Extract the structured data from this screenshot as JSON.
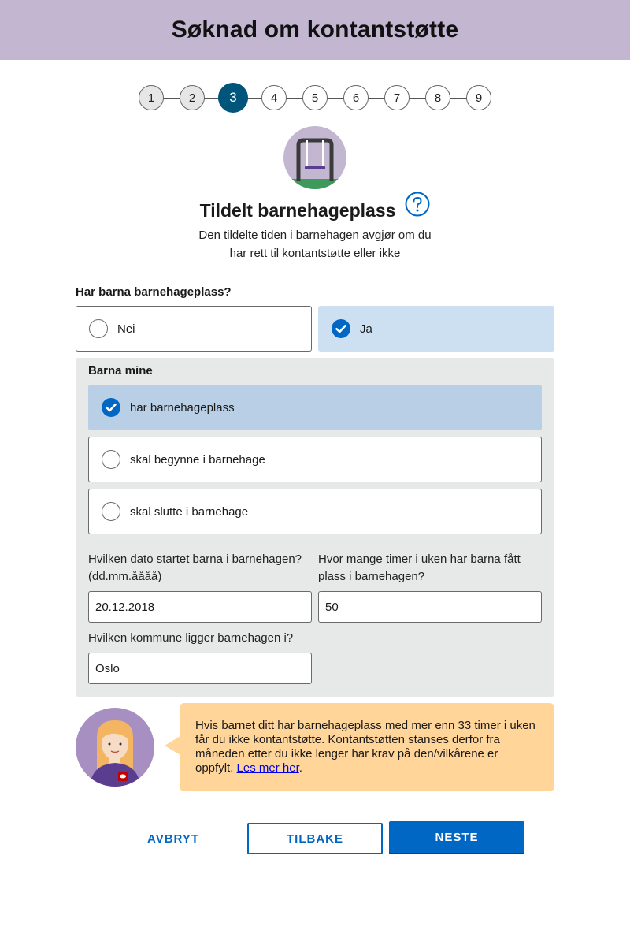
{
  "header": {
    "title": "Søknad om kontantstøtte"
  },
  "stepper": {
    "steps": [
      "1",
      "2",
      "3",
      "4",
      "5",
      "6",
      "7",
      "8",
      "9"
    ],
    "current": "3"
  },
  "section": {
    "title": "Tildelt barnehageplass",
    "subtitle_line1": "Den tildelte tiden i barnehagen avgjør om du",
    "subtitle_line2": "har rett til kontantstøtte eller ikke",
    "help_icon": "question-circle-icon",
    "hero_icon": "swing-icon"
  },
  "question": {
    "label": "Har barna barnehageplass?",
    "options": [
      {
        "label": "Nei",
        "selected": false
      },
      {
        "label": "Ja",
        "selected": true
      }
    ]
  },
  "children": {
    "label": "Barna mine",
    "options": [
      {
        "label": "har barnehageplass",
        "selected": true
      },
      {
        "label": "skal begynne i barnehage",
        "selected": false
      },
      {
        "label": "skal slutte i barnehage",
        "selected": false
      }
    ]
  },
  "fields": {
    "start_date": {
      "label_line1": "Hvilken dato startet barna i barnehagen?",
      "label_line2": "(dd.mm.åååå)",
      "value": "20.12.2018"
    },
    "hours": {
      "label_line1": "Hvor mange timer i uken har barna fått",
      "label_line2": "plass i barnehagen?",
      "value": "50"
    },
    "municipality": {
      "label": "Hvilken kommune ligger barnehagen i?",
      "value": "Oslo"
    }
  },
  "info": {
    "line1": "Hvis barnet ditt har barnehageplass med mer enn 33 timer i uken",
    "line2": "får du ikke kontantstøtte. Kontantstøtten stanses derfor fra",
    "line3": "måneden etter du ikke lenger har krav på den/vilkårene er",
    "line4_prefix": "oppfylt. ",
    "link": "Les mer her",
    "line4_suffix": "."
  },
  "buttons": {
    "cancel": "AVBRYT",
    "back": "TILBAKE",
    "next": "NESTE"
  },
  "colors": {
    "header_bg": "#c2b6d1",
    "accent": "#0067c5",
    "step_active": "#00557a",
    "selected_bg": "#cde0f2",
    "panel_bg": "#e7e9e9",
    "info_bg": "#ffd599"
  }
}
